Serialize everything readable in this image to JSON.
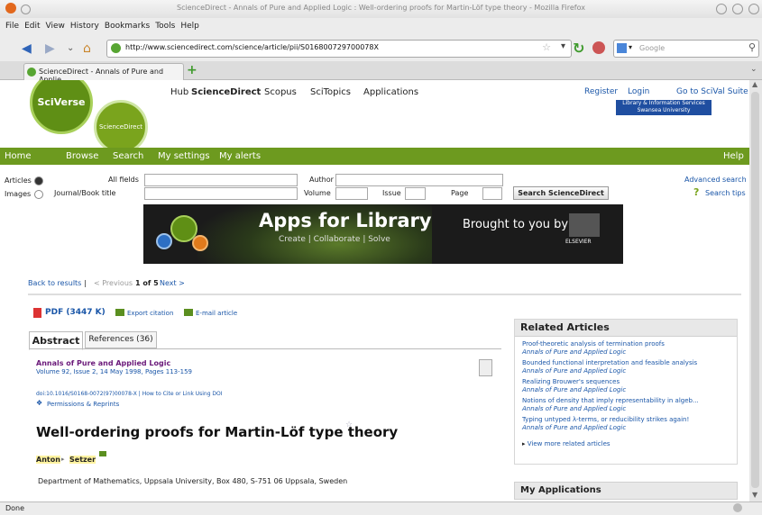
{
  "browser": {
    "window_title": "ScienceDirect - Annals of Pure and Applied Logic : Well-ordering proofs for Martin-Löf type theory - Mozilla Firefox",
    "menu": [
      "File",
      "Edit",
      "View",
      "History",
      "Bookmarks",
      "Tools",
      "Help"
    ],
    "url": "http://www.sciencedirect.com/science/article/pii/S016800729700078X",
    "search_placeholder": "Google",
    "tab_title": "ScienceDirect - Annals of Pure and Applie...",
    "status": "Done"
  },
  "site": {
    "logo_main": "SciVerse",
    "logo_sub": "ScienceDirect",
    "top_nav": [
      "Hub",
      "ScienceDirect",
      "Scopus",
      "SciTopics",
      "Applications"
    ],
    "register": "Register",
    "login": "Login",
    "scival": "Go to SciVal Suite",
    "library_line1": "Library & Information Services",
    "library_line2": "Swansea University",
    "green_nav": [
      "Home",
      "Browse",
      "Search",
      "My settings",
      "My alerts"
    ],
    "help": "Help"
  },
  "search": {
    "articles_label": "Articles",
    "images_label": "Images",
    "all_fields": "All fields",
    "journal_title": "Journal/Book title",
    "author": "Author",
    "volume": "Volume",
    "issue": "Issue",
    "page": "Page",
    "button": "Search ScienceDirect",
    "advanced": "Advanced search",
    "tips": "Search tips"
  },
  "banner": {
    "title": "Apps for Library",
    "subtitle": "Create | Collaborate | Solve",
    "brought": "Brought to you by",
    "publisher": "ELSEVIER"
  },
  "results_nav": {
    "back": "Back to results",
    "previous": "< Previous",
    "position": "1 of 5",
    "next": "Next >"
  },
  "article": {
    "pdf": "PDF (3447 K)",
    "export": "Export citation",
    "email": "E-mail article",
    "tab_abstract": "Abstract",
    "tab_references": "References (36)",
    "journal": "Annals of Pure and Applied Logic",
    "volume_line": "Volume 92, Issue 2, 14 May 1998, Pages 113-159",
    "doi": "doi:10.1016/S0168-0072(97)00078-X | How to Cite or Link Using DOI",
    "permissions": "Permissions & Reprints",
    "title": "Well-ordering proofs for Martin-Löf type theory",
    "author1": "Anton",
    "author2": "Setzer",
    "affiliation": "Department of Mathematics, Uppsala University, Box 480, S-751 06 Uppsala, Sweden"
  },
  "related": {
    "header": "Related Articles",
    "items": [
      {
        "title": "Proof-theoretic analysis of termination proofs",
        "journal": "Annals of Pure and Applied Logic"
      },
      {
        "title": "Bounded functional interpretation and feasible analysis",
        "journal": "Annals of Pure and Applied Logic"
      },
      {
        "title": "Realizing Brouwer's sequences",
        "journal": "Annals of Pure and Applied Logic"
      },
      {
        "title": "Notions of density that imply representability in algeb...",
        "journal": "Annals of Pure and Applied Logic"
      },
      {
        "title": "Typing untyped λ-terms, or reducibility strikes again!",
        "journal": "Annals of Pure and Applied Logic"
      }
    ],
    "more": "View more related articles"
  },
  "my_apps": "My Applications",
  "colors": {
    "green": "#6d9a1f",
    "link": "#1a56a8",
    "title_purple": "#6b1a7a"
  }
}
